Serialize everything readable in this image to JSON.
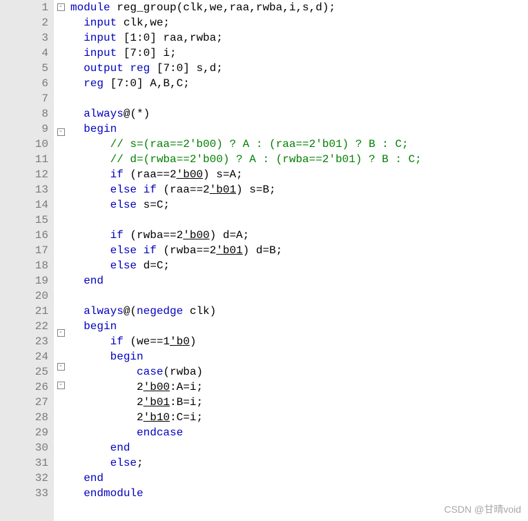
{
  "watermark": "CSDN @甘晴void",
  "total_lines": 33,
  "folds": {
    "1": "-",
    "9": "-",
    "22": "-",
    "24": "-",
    "25": "-"
  },
  "code": [
    [
      {
        "c": "kw",
        "t": "module"
      },
      {
        "c": "txt",
        "t": " reg_group(clk,we,raa,rwba,i,s,d);"
      }
    ],
    [
      {
        "c": "txt",
        "t": "  "
      },
      {
        "c": "kw",
        "t": "input"
      },
      {
        "c": "txt",
        "t": " clk,we;"
      }
    ],
    [
      {
        "c": "txt",
        "t": "  "
      },
      {
        "c": "kw",
        "t": "input"
      },
      {
        "c": "txt",
        "t": " [1:0] raa,rwba;"
      }
    ],
    [
      {
        "c": "txt",
        "t": "  "
      },
      {
        "c": "kw",
        "t": "input"
      },
      {
        "c": "txt",
        "t": " [7:0] i;"
      }
    ],
    [
      {
        "c": "txt",
        "t": "  "
      },
      {
        "c": "kw",
        "t": "output"
      },
      {
        "c": "txt",
        "t": " "
      },
      {
        "c": "kw",
        "t": "reg"
      },
      {
        "c": "txt",
        "t": " [7:0] s,d;"
      }
    ],
    [
      {
        "c": "txt",
        "t": "  "
      },
      {
        "c": "kw",
        "t": "reg"
      },
      {
        "c": "txt",
        "t": " [7:0] A,B,C;"
      }
    ],
    [],
    [
      {
        "c": "txt",
        "t": "  "
      },
      {
        "c": "kw",
        "t": "always"
      },
      {
        "c": "txt",
        "t": "@(*)"
      }
    ],
    [
      {
        "c": "txt",
        "t": "  "
      },
      {
        "c": "kw",
        "t": "begin"
      }
    ],
    [
      {
        "c": "txt",
        "t": "      "
      },
      {
        "c": "cmt",
        "t": "// s=(raa==2'b00) ? A : (raa==2'b01) ? B : C;"
      }
    ],
    [
      {
        "c": "txt",
        "t": "      "
      },
      {
        "c": "cmt",
        "t": "// d=(rwba==2'b00) ? A : (rwba==2'b01) ? B : C;"
      }
    ],
    [
      {
        "c": "txt",
        "t": "      "
      },
      {
        "c": "kw",
        "t": "if"
      },
      {
        "c": "txt",
        "t": " (raa==2"
      },
      {
        "c": "txt tickb",
        "t": "'b00"
      },
      {
        "c": "txt",
        "t": ") s=A;"
      }
    ],
    [
      {
        "c": "txt",
        "t": "      "
      },
      {
        "c": "kw",
        "t": "else"
      },
      {
        "c": "txt",
        "t": " "
      },
      {
        "c": "kw",
        "t": "if"
      },
      {
        "c": "txt",
        "t": " (raa==2"
      },
      {
        "c": "txt tickb",
        "t": "'b01"
      },
      {
        "c": "txt",
        "t": ") s=B;"
      }
    ],
    [
      {
        "c": "txt",
        "t": "      "
      },
      {
        "c": "kw",
        "t": "else"
      },
      {
        "c": "txt",
        "t": " s=C;"
      }
    ],
    [],
    [
      {
        "c": "txt",
        "t": "      "
      },
      {
        "c": "kw",
        "t": "if"
      },
      {
        "c": "txt",
        "t": " (rwba==2"
      },
      {
        "c": "txt tickb",
        "t": "'b00"
      },
      {
        "c": "txt",
        "t": ") d=A;"
      }
    ],
    [
      {
        "c": "txt",
        "t": "      "
      },
      {
        "c": "kw",
        "t": "else"
      },
      {
        "c": "txt",
        "t": " "
      },
      {
        "c": "kw",
        "t": "if"
      },
      {
        "c": "txt",
        "t": " (rwba==2"
      },
      {
        "c": "txt tickb",
        "t": "'b01"
      },
      {
        "c": "txt",
        "t": ") d=B;"
      }
    ],
    [
      {
        "c": "txt",
        "t": "      "
      },
      {
        "c": "kw",
        "t": "else"
      },
      {
        "c": "txt",
        "t": " d=C;"
      }
    ],
    [
      {
        "c": "txt",
        "t": "  "
      },
      {
        "c": "kw",
        "t": "end"
      }
    ],
    [],
    [
      {
        "c": "txt",
        "t": "  "
      },
      {
        "c": "kw",
        "t": "always"
      },
      {
        "c": "txt",
        "t": "@("
      },
      {
        "c": "kw",
        "t": "negedge"
      },
      {
        "c": "txt",
        "t": " clk)"
      }
    ],
    [
      {
        "c": "txt",
        "t": "  "
      },
      {
        "c": "kw",
        "t": "begin"
      }
    ],
    [
      {
        "c": "txt",
        "t": "      "
      },
      {
        "c": "kw",
        "t": "if"
      },
      {
        "c": "txt",
        "t": " (we==1"
      },
      {
        "c": "txt tickb",
        "t": "'b0"
      },
      {
        "c": "txt",
        "t": ")"
      }
    ],
    [
      {
        "c": "txt",
        "t": "      "
      },
      {
        "c": "kw",
        "t": "begin"
      }
    ],
    [
      {
        "c": "txt",
        "t": "          "
      },
      {
        "c": "kw",
        "t": "case"
      },
      {
        "c": "txt",
        "t": "(rwba)"
      }
    ],
    [
      {
        "c": "txt",
        "t": "          2"
      },
      {
        "c": "txt tickb",
        "t": "'b00"
      },
      {
        "c": "txt",
        "t": ":A=i;"
      }
    ],
    [
      {
        "c": "txt",
        "t": "          2"
      },
      {
        "c": "txt tickb",
        "t": "'b01"
      },
      {
        "c": "txt",
        "t": ":B=i;"
      }
    ],
    [
      {
        "c": "txt",
        "t": "          2"
      },
      {
        "c": "txt tickb",
        "t": "'b10"
      },
      {
        "c": "txt",
        "t": ":C=i;"
      }
    ],
    [
      {
        "c": "txt",
        "t": "          "
      },
      {
        "c": "kw",
        "t": "endcase"
      }
    ],
    [
      {
        "c": "txt",
        "t": "      "
      },
      {
        "c": "kw",
        "t": "end"
      }
    ],
    [
      {
        "c": "txt",
        "t": "      "
      },
      {
        "c": "kw",
        "t": "else"
      },
      {
        "c": "txt",
        "t": ";"
      }
    ],
    [
      {
        "c": "txt",
        "t": "  "
      },
      {
        "c": "kw",
        "t": "end"
      }
    ],
    [
      {
        "c": "txt",
        "t": "  "
      },
      {
        "c": "kw",
        "t": "endmodule"
      }
    ]
  ]
}
